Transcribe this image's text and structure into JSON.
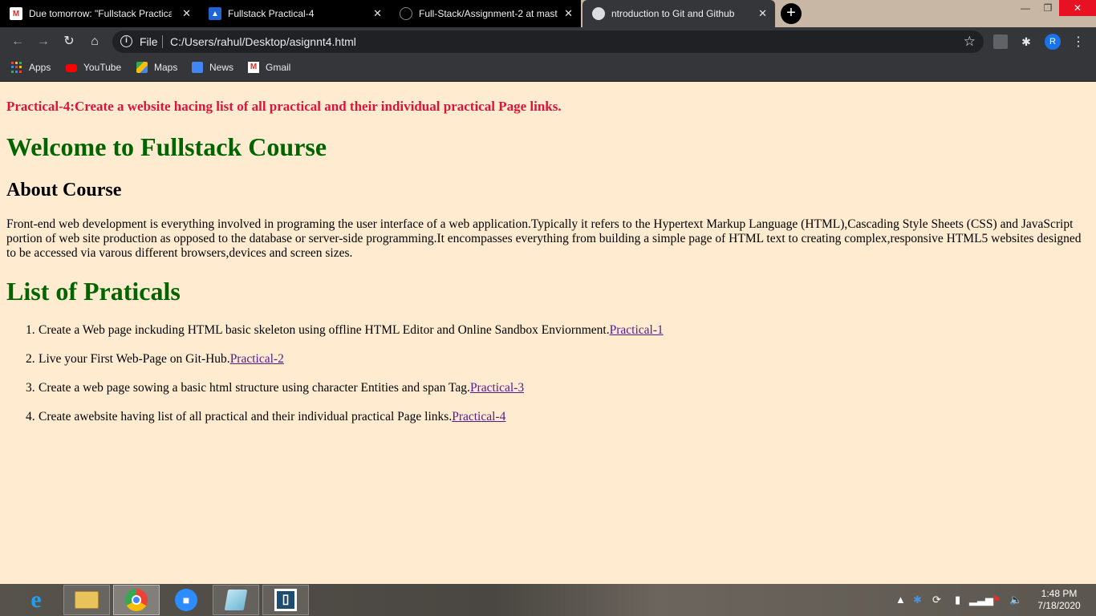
{
  "browser": {
    "tabs": [
      {
        "title": "Due tomorrow: \"Fullstack Practica",
        "icon": "gmail-icon"
      },
      {
        "title": "Fullstack Practical-4",
        "icon": "classroom-icon"
      },
      {
        "title": "Full-Stack/Assignment-2 at mast",
        "icon": "github-icon"
      },
      {
        "title": "ntroduction to Git and Github",
        "icon": "globe-icon"
      }
    ],
    "address": {
      "scheme": "File",
      "url": "C:/Users/rahul/Desktop/asignnt4.html"
    },
    "profile_initial": "R",
    "bookmarks": [
      "Apps",
      "YouTube",
      "Maps",
      "News",
      "Gmail"
    ]
  },
  "page": {
    "intro": "Practical-4:Create a website hacing list of all practical and their individual practical Page links.",
    "welcome": "Welcome to Fullstack Course",
    "about_heading": "About Course",
    "about_text": "Front-end web development is everything involved in programing the user interface of a web application.Typically it refers to the Hypertext Markup Language (HTML),Cascading Style Sheets (CSS) and JavaScript portion of web site production as opposed to the database or server-side programming.It encompasses everything from building a simple page of HTML text to creating complex,responsive HTML5 websites designed to be accessed via varous different browsers,devices and screen sizes.",
    "list_heading": "List of Praticals",
    "practicals": [
      {
        "num": "1.",
        "text": "Create a Web page inckuding HTML basic skeleton using offline HTML Editor and Online Sandbox Enviornment.",
        "link": "Practical-1"
      },
      {
        "num": "2.",
        "text": "Live your First Web-Page on Git-Hub.",
        "link": "Practical-2"
      },
      {
        "num": "3.",
        "text": "Create a web page sowing a basic html structure using character Entities and span Tag.",
        "link": "Practical-3"
      },
      {
        "num": "4.",
        "text": "Create awebsite having list of all practical and their individual practical Page links.",
        "link": "Practical-4"
      }
    ]
  },
  "taskbar": {
    "apps": [
      "internet-explorer-icon",
      "file-explorer-icon",
      "chrome-icon",
      "zoom-icon",
      "notepad-icon",
      "app-icon"
    ],
    "time": "1:48 PM",
    "date": "7/18/2020"
  },
  "colors": {
    "page_bg": "#ffecd0",
    "intro": "#dc143c",
    "heading_green": "#006400",
    "link": "#551a8b"
  }
}
